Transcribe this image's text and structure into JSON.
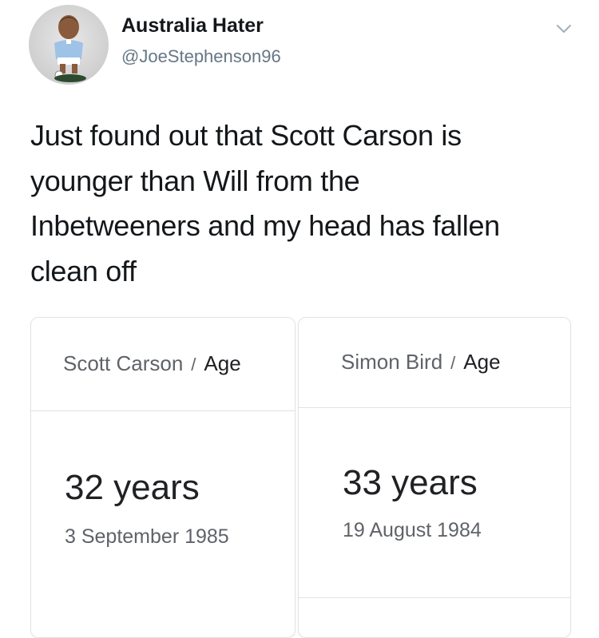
{
  "tweet": {
    "display_name": "Australia Hater",
    "handle": "@JoeStephenson96",
    "menu_icon": "chevron-down-icon",
    "text_lines": [
      "Just found out that Scott Carson is",
      "younger than Will from the",
      "Inbetweeners and my head has fallen",
      "clean off"
    ]
  },
  "cards": [
    {
      "subject": "Scott Carson",
      "separator": "/",
      "attribute": "Age",
      "age": "32 years",
      "dob": "3 September 1985"
    },
    {
      "subject": "Simon Bird",
      "separator": "/",
      "attribute": "Age",
      "age": "33 years",
      "dob": "19 August 1984"
    }
  ],
  "colors": {
    "text_primary": "#14171a",
    "text_secondary": "#657786",
    "card_muted": "#5f6368",
    "card_border": "#e3e3e3"
  }
}
